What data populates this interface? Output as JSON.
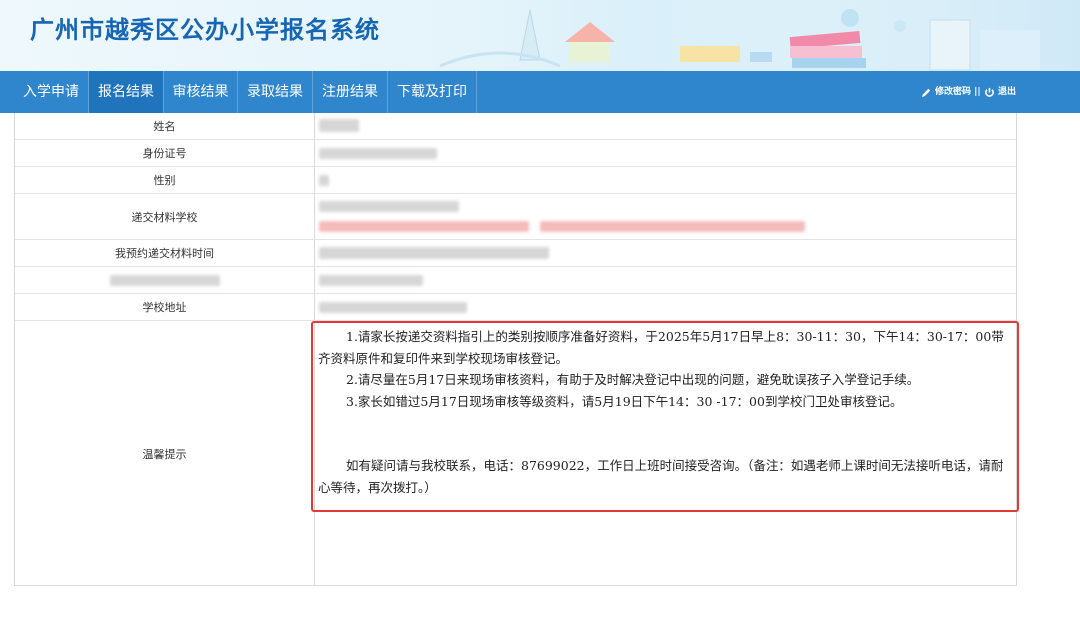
{
  "header": {
    "title": "广州市越秀区公办小学报名系统"
  },
  "nav": {
    "items": [
      {
        "label": "入学申请"
      },
      {
        "label": "报名结果"
      },
      {
        "label": "审核结果"
      },
      {
        "label": "录取结果"
      },
      {
        "label": "注册结果"
      },
      {
        "label": "下载及打印"
      }
    ],
    "active_item": "报名结果",
    "change_password": "修改密码",
    "separator": "||",
    "logout": "退出"
  },
  "info_table": {
    "rows": [
      {
        "label": "姓名"
      },
      {
        "label": "身份证号"
      },
      {
        "label": "性别"
      },
      {
        "label": "递交材料学校"
      },
      {
        "label": "我预约递交材料时间"
      },
      {
        "label": ""
      },
      {
        "label": "学校地址"
      },
      {
        "label": "温馨提示"
      }
    ]
  },
  "notice": {
    "item1": "1.请家长按递交资料指引上的类别按顺序准备好资料，于2025年5月17日早上8：30-11：30，下午14：30-17：00带齐资料原件和复印件来到学校现场审核登记。",
    "item2": "2.请尽量在5月17日来现场审核资料，有助于及时解决登记中出现的问题，避免耽误孩子入学登记手续。",
    "item3": "3.家长如错过5月17日现场审核等级资料，请5月19日下午14：30 -17：00到学校门卫处审核登记。",
    "contact": "如有疑问请与我校联系，电话：87699022，工作日上班时间接受咨询。（备注：如遇老师上课时间无法接听电话，请耐心等待，再次拨打。）"
  },
  "colors": {
    "nav_bg": "#2f86cc",
    "nav_active": "#1f74bb",
    "title": "#1766b4",
    "highlight_border": "#e53935"
  }
}
